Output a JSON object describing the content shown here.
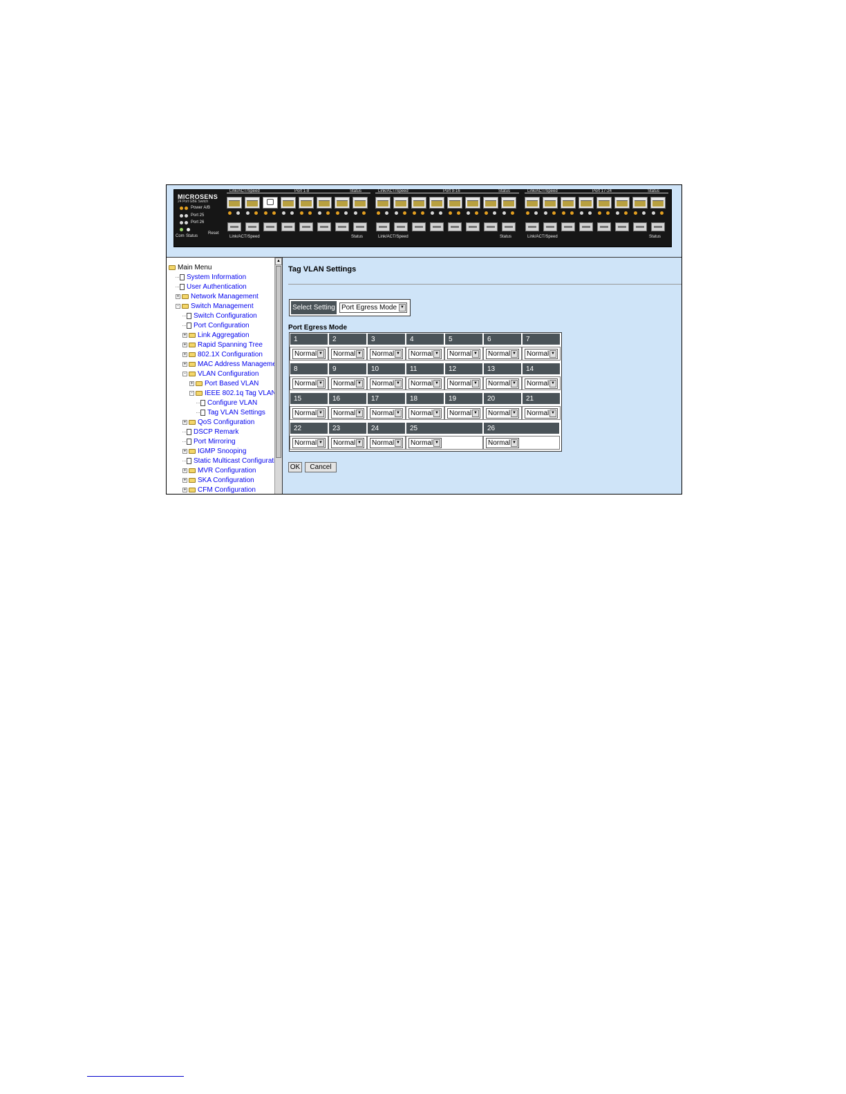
{
  "panel": {
    "brand": "MICROSENS",
    "subtitle": "24 Port GBE Switch",
    "power_label": "Power A/B",
    "port25_label": "Port 25",
    "port26_label": "Port 26",
    "com_label": "Com",
    "status_label": "Status",
    "reset_label": "Reset",
    "groups": [
      {
        "top_left": "Link/ACT/Speed",
        "center": "Port 1-8",
        "top_right": "Status",
        "bottom_left": "Link/ACT/Speed",
        "bottom_right": "Status"
      },
      {
        "top_left": "Link/ACT/Speed",
        "center": "Port 9-16",
        "top_right": "Status",
        "bottom_left": "Link/ACT/Speed",
        "bottom_right": "Status"
      },
      {
        "top_left": "Link/ACT/Speed",
        "center": "Port 17-24",
        "top_right": "Status",
        "bottom_left": "Link/ACT/Speed",
        "bottom_right": "Status"
      }
    ],
    "led_color": "#e4a020"
  },
  "sidebar": {
    "items": [
      {
        "label": "Main Menu",
        "level": 0,
        "icon": "folder-open-icon",
        "toggle": "",
        "root": true
      },
      {
        "label": "System Information",
        "level": 1,
        "icon": "page-icon",
        "toggle": ""
      },
      {
        "label": "User Authentication",
        "level": 1,
        "icon": "page-icon",
        "toggle": ""
      },
      {
        "label": "Network Management",
        "level": 1,
        "icon": "folder-icon",
        "toggle": "+"
      },
      {
        "label": "Switch Management",
        "level": 1,
        "icon": "folder-open-icon",
        "toggle": "-"
      },
      {
        "label": "Switch Configuration",
        "level": 2,
        "icon": "page-icon",
        "toggle": ""
      },
      {
        "label": "Port Configuration",
        "level": 2,
        "icon": "page-icon",
        "toggle": ""
      },
      {
        "label": "Link Aggregation",
        "level": 2,
        "icon": "folder-icon",
        "toggle": "+"
      },
      {
        "label": "Rapid Spanning Tree",
        "level": 2,
        "icon": "folder-icon",
        "toggle": "+"
      },
      {
        "label": "802.1X Configuration",
        "level": 2,
        "icon": "folder-icon",
        "toggle": "+"
      },
      {
        "label": "MAC Address Managemen",
        "level": 2,
        "icon": "folder-icon",
        "toggle": "+"
      },
      {
        "label": "VLAN Configuration",
        "level": 2,
        "icon": "folder-open-icon",
        "toggle": "-"
      },
      {
        "label": "Port Based VLAN",
        "level": 3,
        "icon": "folder-icon",
        "toggle": "+"
      },
      {
        "label": "IEEE 802.1q Tag VLAN",
        "level": 3,
        "icon": "folder-open-icon",
        "toggle": "-"
      },
      {
        "label": "Configure VLAN",
        "level": 4,
        "icon": "page-icon",
        "toggle": ""
      },
      {
        "label": "Tag VLAN Settings",
        "level": 4,
        "icon": "page-icon",
        "toggle": ""
      },
      {
        "label": "QoS Configuration",
        "level": 2,
        "icon": "folder-icon",
        "toggle": "+"
      },
      {
        "label": "DSCP Remark",
        "level": 2,
        "icon": "page-icon",
        "toggle": ""
      },
      {
        "label": "Port Mirroring",
        "level": 2,
        "icon": "page-icon",
        "toggle": ""
      },
      {
        "label": "IGMP Snooping",
        "level": 2,
        "icon": "folder-icon",
        "toggle": "+"
      },
      {
        "label": "Static Multicast Configuratio",
        "level": 2,
        "icon": "page-icon",
        "toggle": ""
      },
      {
        "label": "MVR Configuration",
        "level": 2,
        "icon": "folder-icon",
        "toggle": "+"
      },
      {
        "label": "SKA Configuration",
        "level": 2,
        "icon": "folder-icon",
        "toggle": "+"
      },
      {
        "label": "CFM Configuration",
        "level": 2,
        "icon": "folder-icon",
        "toggle": "+"
      }
    ]
  },
  "main": {
    "title": "Tag VLAN Settings",
    "select_setting": {
      "label": "Select Setting",
      "value": "Port Egress Mode"
    },
    "section_title": "Port Egress Mode",
    "ports": [
      {
        "port": "1",
        "mode": "Normal"
      },
      {
        "port": "2",
        "mode": "Normal"
      },
      {
        "port": "3",
        "mode": "Normal"
      },
      {
        "port": "4",
        "mode": "Normal"
      },
      {
        "port": "5",
        "mode": "Normal"
      },
      {
        "port": "6",
        "mode": "Normal"
      },
      {
        "port": "7",
        "mode": "Normal"
      },
      {
        "port": "8",
        "mode": "Normal"
      },
      {
        "port": "9",
        "mode": "Normal"
      },
      {
        "port": "10",
        "mode": "Normal"
      },
      {
        "port": "11",
        "mode": "Normal"
      },
      {
        "port": "12",
        "mode": "Normal"
      },
      {
        "port": "13",
        "mode": "Normal"
      },
      {
        "port": "14",
        "mode": "Normal"
      },
      {
        "port": "15",
        "mode": "Normal"
      },
      {
        "port": "16",
        "mode": "Normal"
      },
      {
        "port": "17",
        "mode": "Normal"
      },
      {
        "port": "18",
        "mode": "Normal"
      },
      {
        "port": "19",
        "mode": "Normal"
      },
      {
        "port": "20",
        "mode": "Normal"
      },
      {
        "port": "21",
        "mode": "Normal"
      },
      {
        "port": "22",
        "mode": "Normal"
      },
      {
        "port": "23",
        "mode": "Normal"
      },
      {
        "port": "24",
        "mode": "Normal"
      },
      {
        "port": "25",
        "mode": "Normal"
      },
      {
        "port": "26",
        "mode": "Normal"
      }
    ],
    "ok_label": "OK",
    "cancel_label": "Cancel"
  }
}
